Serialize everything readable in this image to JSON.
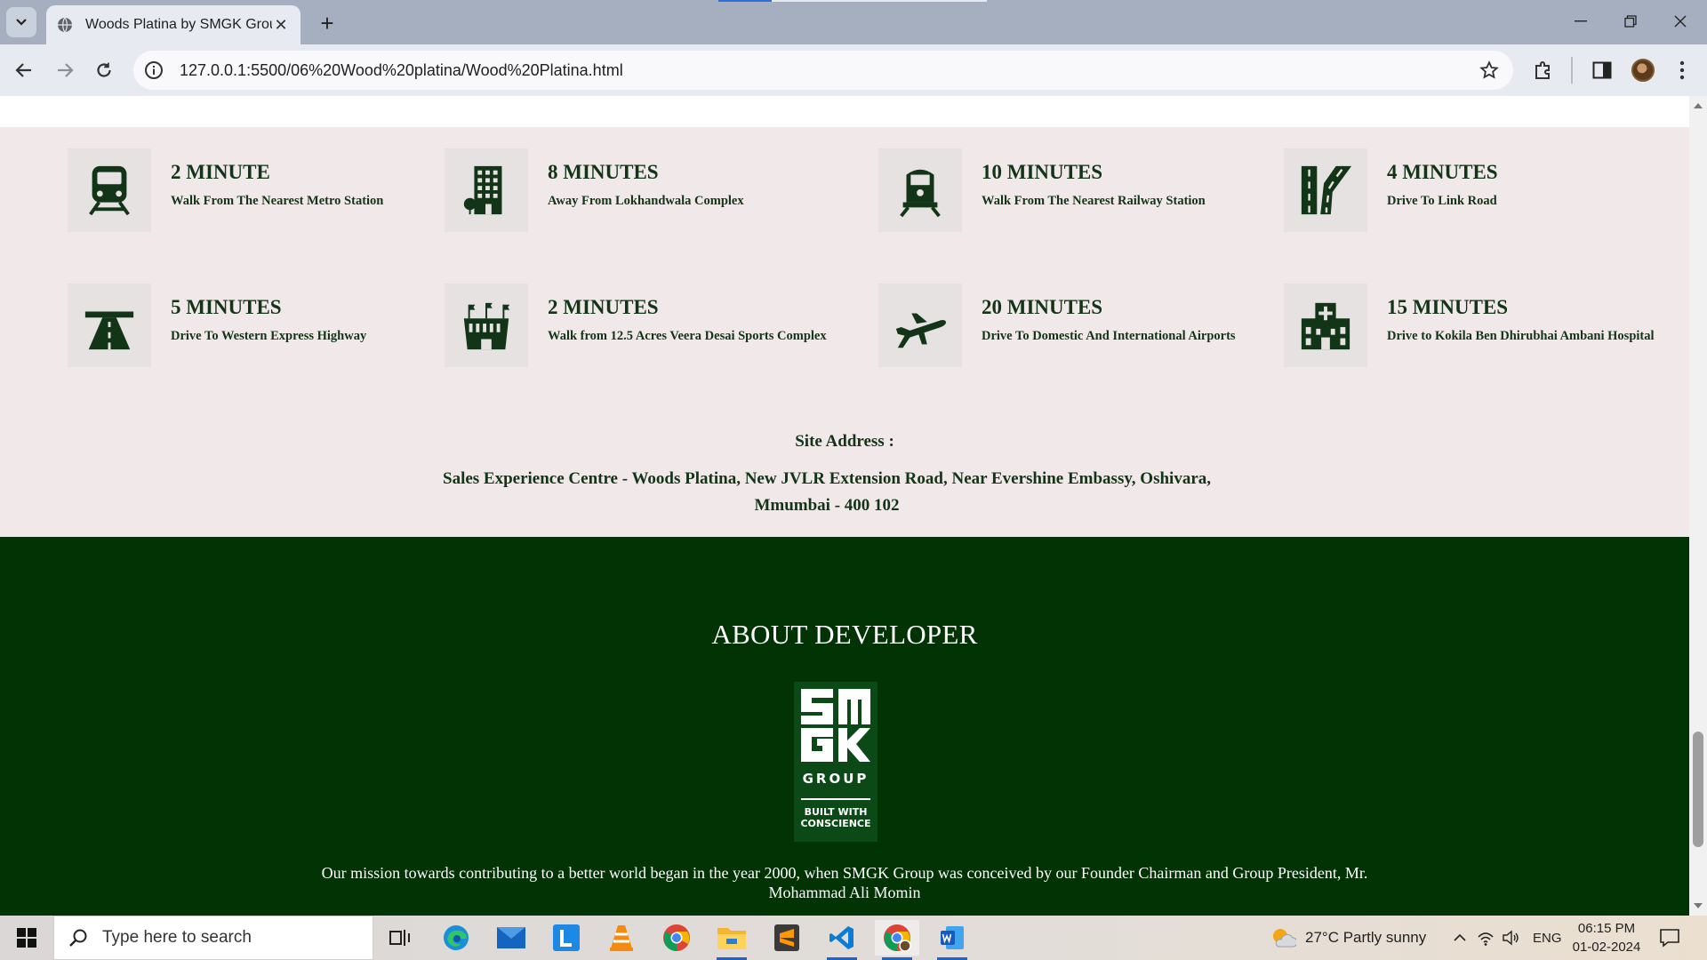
{
  "browser": {
    "tab_title": "Woods Platina by SMGK Group",
    "tab_close": "✕",
    "new_tab": "+",
    "url": "127.0.0.1:5500/06%20Wood%20platina/Wood%20Platina.html"
  },
  "locations": [
    {
      "time": "2 MINUTE",
      "desc": "Walk From The Nearest Metro Station",
      "icon": "metro-icon"
    },
    {
      "time": "8 MINUTES",
      "desc": "Away From Lokhandwala Complex",
      "icon": "building-icon"
    },
    {
      "time": "10 MINUTES",
      "desc": "Walk From The Nearest Railway Station",
      "icon": "train-icon"
    },
    {
      "time": "4 MINUTES",
      "desc": "Drive To Link Road",
      "icon": "road-icon"
    },
    {
      "time": "5 MINUTES",
      "desc": "Drive To Western Express Highway",
      "icon": "highway-icon"
    },
    {
      "time": "2 MINUTES",
      "desc": "Walk from 12.5 Acres Veera Desai Sports Complex",
      "icon": "stadium-icon"
    },
    {
      "time": "20 MINUTES",
      "desc": "Drive To Domestic And International Airports",
      "icon": "airplane-icon"
    },
    {
      "time": "15 MINUTES",
      "desc": "Drive to Kokila Ben Dhirubhai Ambani Hospital",
      "icon": "hospital-icon"
    }
  ],
  "site": {
    "label": "Site Address :",
    "address": "Sales Experience Centre - Woods Platina, New JVLR Extension Road, Near Evershine Embassy, Oshivara, Mmumbai - 400 102"
  },
  "about": {
    "title": "ABOUT DEVELOPER",
    "logo_group": "GROUP",
    "logo_tag": "BUILT WITH CONSCIENCE",
    "logo_letters": "SMGK",
    "mission": "Our mission towards contributing to a better world began in the year 2000, when SMGK Group was conceived by our Founder Chairman and Group President, Mr. Mohammad Ali Momin"
  },
  "taskbar": {
    "search_placeholder": "Type here to search",
    "weather": "27°C  Partly sunny",
    "language": "ENG",
    "time": "06:15 PM",
    "date": "01-02-2024"
  },
  "colors": {
    "page_bg": "#f1e9e9",
    "dark_green": "#123417",
    "about_bg": "#023304",
    "chrome_tabbar": "#a5afc0"
  }
}
